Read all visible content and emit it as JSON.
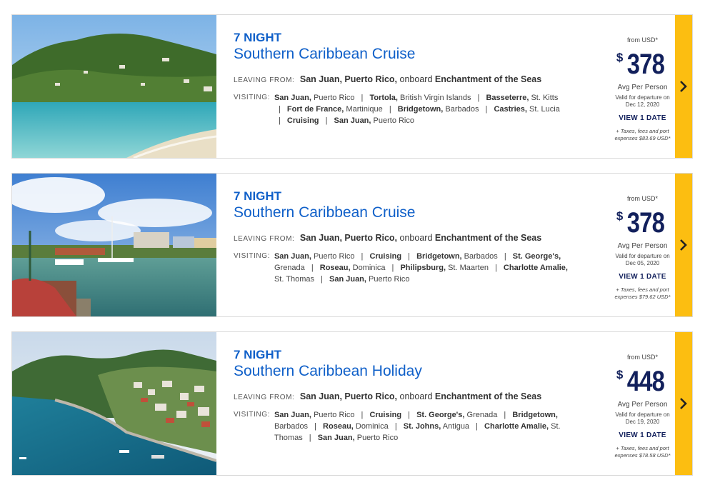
{
  "cruises": [
    {
      "nights": "7 NIGHT",
      "title": "Southern Caribbean Cruise",
      "leaving_label": "LEAVING FROM:",
      "leaving_port": "San Juan, Puerto Rico,",
      "onboard_text": "onboard",
      "ship": "Enchantment of the Seas",
      "visiting_label": "VISITING:",
      "ports": [
        {
          "name": "San Juan,",
          "region": "Puerto Rico"
        },
        {
          "name": "Tortola,",
          "region": "British Virgin Islands"
        },
        {
          "name": "Basseterre,",
          "region": "St. Kitts"
        },
        {
          "name": "Fort de France,",
          "region": "Martinique"
        },
        {
          "name": "Bridgetown,",
          "region": "Barbados"
        },
        {
          "name": "Castries,",
          "region": "St. Lucia"
        },
        {
          "name": "Cruising",
          "region": ""
        },
        {
          "name": "San Juan,",
          "region": "Puerto Rico"
        }
      ],
      "from_label": "from USD*",
      "currency_symbol": "$",
      "price": "378",
      "avg_label": "Avg Per Person",
      "valid_text": "Valid for departure on",
      "valid_date": "Dec 12, 2020",
      "view_label": "VIEW 1 DATE",
      "taxes_text": "+ Taxes, fees and port",
      "taxes_amount": "expenses $83.69 USD*"
    },
    {
      "nights": "7 NIGHT",
      "title": "Southern Caribbean Cruise",
      "leaving_label": "LEAVING FROM:",
      "leaving_port": "San Juan, Puerto Rico,",
      "onboard_text": "onboard",
      "ship": "Enchantment of the Seas",
      "visiting_label": "VISITING:",
      "ports": [
        {
          "name": "San Juan,",
          "region": "Puerto Rico"
        },
        {
          "name": "Cruising",
          "region": ""
        },
        {
          "name": "Bridgetown,",
          "region": "Barbados"
        },
        {
          "name": "St. George's,",
          "region": "Grenada"
        },
        {
          "name": "Roseau,",
          "region": "Dominica"
        },
        {
          "name": "Philipsburg,",
          "region": "St. Maarten"
        },
        {
          "name": "Charlotte Amalie,",
          "region": "St. Thomas"
        },
        {
          "name": "San Juan,",
          "region": "Puerto Rico"
        }
      ],
      "from_label": "from USD*",
      "currency_symbol": "$",
      "price": "378",
      "avg_label": "Avg Per Person",
      "valid_text": "Valid for departure on",
      "valid_date": "Dec 05, 2020",
      "view_label": "VIEW 1 DATE",
      "taxes_text": "+ Taxes, fees and port",
      "taxes_amount": "expenses $79.62 USD*"
    },
    {
      "nights": "7 NIGHT",
      "title": "Southern Caribbean Holiday",
      "leaving_label": "LEAVING FROM:",
      "leaving_port": "San Juan, Puerto Rico,",
      "onboard_text": "onboard",
      "ship": "Enchantment of the Seas",
      "visiting_label": "VISITING:",
      "ports": [
        {
          "name": "San Juan,",
          "region": "Puerto Rico"
        },
        {
          "name": "Cruising",
          "region": ""
        },
        {
          "name": "St. George's,",
          "region": "Grenada"
        },
        {
          "name": "Bridgetown,",
          "region": "Barbados"
        },
        {
          "name": "Roseau,",
          "region": "Dominica"
        },
        {
          "name": "St. Johns,",
          "region": "Antigua"
        },
        {
          "name": "Charlotte Amalie,",
          "region": "St. Thomas"
        },
        {
          "name": "San Juan,",
          "region": "Puerto Rico"
        }
      ],
      "from_label": "from USD*",
      "currency_symbol": "$",
      "price": "448",
      "avg_label": "Avg Per Person",
      "valid_text": "Valid for departure on",
      "valid_date": "Dec 19, 2020",
      "view_label": "VIEW 1 DATE",
      "taxes_text": "+ Taxes, fees and port",
      "taxes_amount": "expenses $78.58 USD*"
    }
  ],
  "colors": {
    "accent_blue": "#1060c9",
    "price_navy": "#12205c",
    "arrow_yellow": "#fcbe11"
  },
  "icons": {
    "next_arrow": "chevron-right-icon"
  }
}
